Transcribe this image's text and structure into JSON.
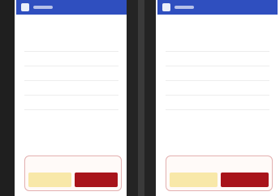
{
  "theme": {
    "header_color": "#2f4fbf",
    "danger_color": "#a8141b",
    "warning_color": "#f8e8a9",
    "dark_band_color": "#1f1f1f"
  },
  "panels": [
    {
      "header": {
        "logo_icon": "app-logo-icon",
        "title": ""
      },
      "heading": "",
      "items": [
        {
          "label": ""
        },
        {
          "label": ""
        },
        {
          "label": ""
        },
        {
          "label": ""
        },
        {
          "label": ""
        }
      ],
      "dialog": {
        "title": "",
        "secondary_label": "",
        "primary_label": ""
      }
    },
    {
      "header": {
        "logo_icon": "app-logo-icon",
        "title": ""
      },
      "heading": "",
      "items": [
        {
          "label": ""
        },
        {
          "label": ""
        },
        {
          "label": ""
        },
        {
          "label": ""
        },
        {
          "label": ""
        }
      ],
      "dialog": {
        "title": "",
        "secondary_label": "",
        "primary_label": ""
      }
    }
  ]
}
